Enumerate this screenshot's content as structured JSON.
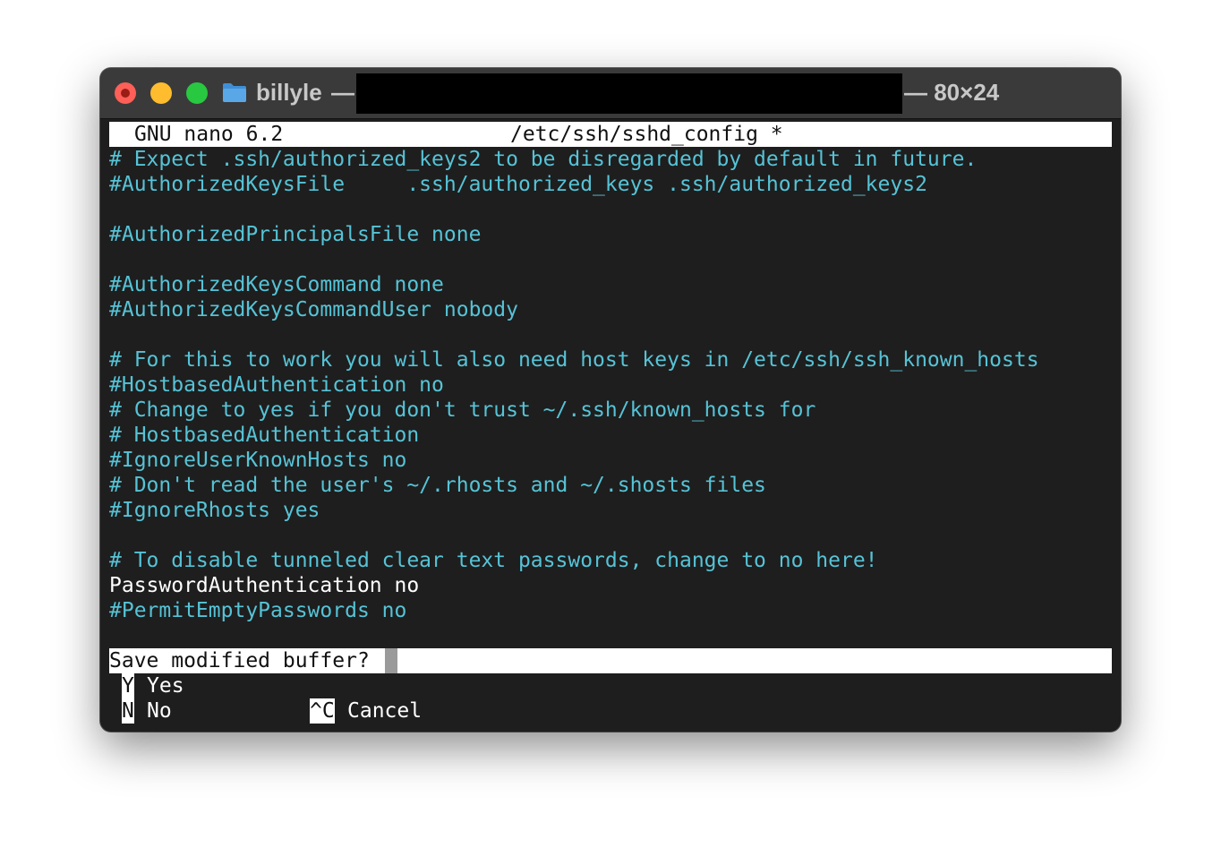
{
  "window": {
    "title_left": "billyle",
    "title_dash": "—",
    "title_right": "— 80×24",
    "folder_icon": "folder-icon"
  },
  "nano": {
    "version_label": "GNU nano 6.2",
    "filename": "/etc/ssh/sshd_config *"
  },
  "lines": [
    {
      "text": "# Expect .ssh/authorized_keys2 to be disregarded by default in future.",
      "color": "#56c3d6"
    },
    {
      "text": "#AuthorizedKeysFile     .ssh/authorized_keys .ssh/authorized_keys2",
      "color": "#56c3d6"
    },
    {
      "text": "",
      "color": "#56c3d6"
    },
    {
      "text": "#AuthorizedPrincipalsFile none",
      "color": "#56c3d6"
    },
    {
      "text": "",
      "color": "#56c3d6"
    },
    {
      "text": "#AuthorizedKeysCommand none",
      "color": "#56c3d6"
    },
    {
      "text": "#AuthorizedKeysCommandUser nobody",
      "color": "#56c3d6"
    },
    {
      "text": "",
      "color": "#56c3d6"
    },
    {
      "text": "# For this to work you will also need host keys in /etc/ssh/ssh_known_hosts",
      "color": "#56c3d6"
    },
    {
      "text": "#HostbasedAuthentication no",
      "color": "#56c3d6"
    },
    {
      "text": "# Change to yes if you don't trust ~/.ssh/known_hosts for",
      "color": "#56c3d6"
    },
    {
      "text": "# HostbasedAuthentication",
      "color": "#56c3d6"
    },
    {
      "text": "#IgnoreUserKnownHosts no",
      "color": "#56c3d6"
    },
    {
      "text": "# Don't read the user's ~/.rhosts and ~/.shosts files",
      "color": "#56c3d6"
    },
    {
      "text": "#IgnoreRhosts yes",
      "color": "#56c3d6"
    },
    {
      "text": "",
      "color": "#56c3d6"
    },
    {
      "text": "# To disable tunneled clear text passwords, change to no here!",
      "color": "#56c3d6"
    },
    {
      "text": "PasswordAuthentication no",
      "color": "#ffffff"
    },
    {
      "text": "#PermitEmptyPasswords no",
      "color": "#56c3d6"
    }
  ],
  "prompt": {
    "question": "Save modified buffer?"
  },
  "options": {
    "yes_key": "Y",
    "yes_label": "Yes",
    "no_key": "N",
    "no_label": "No",
    "cancel_key": "^C",
    "cancel_label": "Cancel"
  }
}
